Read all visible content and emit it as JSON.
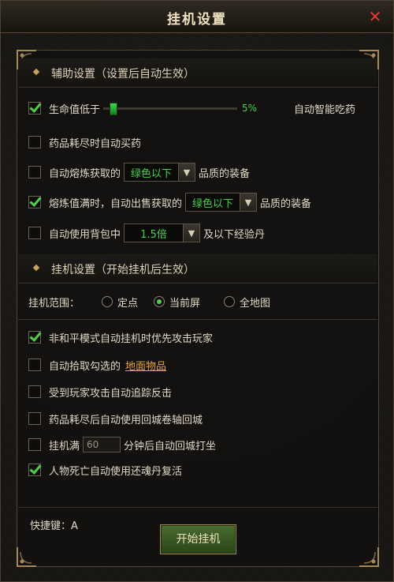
{
  "window": {
    "title": "挂机设置",
    "close_label": "✕"
  },
  "assist": {
    "header": "辅助设置（设置后自动生效）",
    "hp": {
      "checked": true,
      "label": "生命值低于",
      "percent": "5%",
      "suffix": "自动智能吃药",
      "slider_value": 0.05
    },
    "buy_potion": {
      "checked": false,
      "label": "药品耗尽时自动买药"
    },
    "refine": {
      "checked": false,
      "prefix": "自动熔炼获取的",
      "value": "绿色以下",
      "suffix": "品质的装备"
    },
    "sell": {
      "checked": true,
      "prefix": "熔炼值满时，自动出售获取的",
      "value": "绿色以下",
      "suffix": "品质的装备"
    },
    "exp_pill": {
      "checked": false,
      "prefix": "自动使用背包中",
      "value": "1.5倍",
      "suffix": "及以下经验丹"
    }
  },
  "idle": {
    "header": "挂机设置（开始挂机后生效）",
    "range_label": "挂机范围：",
    "range_options": [
      {
        "label": "定点",
        "selected": false
      },
      {
        "label": "当前屏",
        "selected": true
      },
      {
        "label": "全地图",
        "selected": false
      }
    ],
    "pvp": {
      "checked": true,
      "label": "非和平模式自动挂机时优先攻击玩家"
    },
    "pickup": {
      "checked": false,
      "label": "自动拾取勾选的",
      "link": "地面物品"
    },
    "counter": {
      "checked": false,
      "label": "受到玩家攻击自动追踪反击"
    },
    "scroll": {
      "checked": false,
      "label": "药品耗尽后自动使用回城卷轴回城"
    },
    "timer": {
      "checked": false,
      "prefix": "挂机满",
      "value": "60",
      "suffix": "分钟后自动回城打坐"
    },
    "revive": {
      "checked": true,
      "label": "人物死亡自动使用还魂丹复活"
    }
  },
  "footer": {
    "hotkey": "快捷键：A",
    "start_label": "开始挂机"
  }
}
